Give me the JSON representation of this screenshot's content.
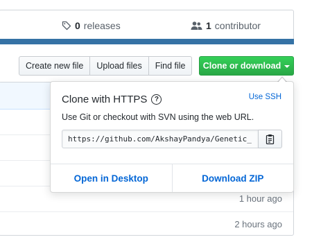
{
  "summary": {
    "releases_count": "0",
    "releases_label": "releases",
    "contributors_count": "1",
    "contributors_label": "contributor"
  },
  "file_nav": {
    "create_file": "Create new file",
    "upload_files": "Upload files",
    "find_file": "Find file",
    "clone_download": "Clone or download"
  },
  "clone_dropdown": {
    "title": "Clone with HTTPS",
    "use_ssh": "Use SSH",
    "description": "Use Git or checkout with SVN using the web URL.",
    "url": "https://github.com/AkshayPandya/Genetic_",
    "open_desktop": "Open in Desktop",
    "download_zip": "Download ZIP"
  },
  "files": [
    {
      "age": ""
    },
    {
      "age": ""
    },
    {
      "age": ""
    },
    {
      "age": "1 hour ago"
    },
    {
      "age": "2 hours ago"
    }
  ],
  "colors": {
    "language_bar": "#3572A5",
    "clone_button": "#28a745",
    "link": "#0366d6"
  }
}
